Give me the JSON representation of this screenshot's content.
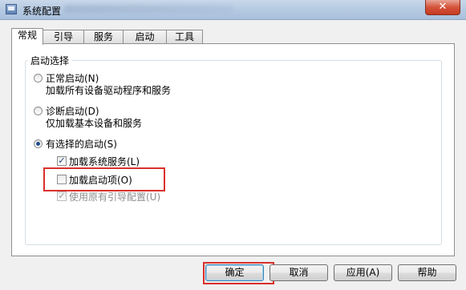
{
  "window": {
    "title": "系统配置",
    "close_glyph": "✕"
  },
  "tabs": [
    {
      "label": "常规",
      "active": true
    },
    {
      "label": "引导"
    },
    {
      "label": "服务"
    },
    {
      "label": "启动"
    },
    {
      "label": "工具"
    }
  ],
  "startup": {
    "group_label": "启动选择",
    "normal": {
      "label": "正常启动(N)",
      "desc": "加载所有设备驱动程序和服务",
      "selected": false
    },
    "diagnostic": {
      "label": "诊断启动(D)",
      "desc": "仅加载基本设备和服务",
      "selected": false
    },
    "selective": {
      "label": "有选择的启动(S)",
      "selected": true
    },
    "options": [
      {
        "label": "加载系统服务(L)",
        "checked": true,
        "enabled": true
      },
      {
        "label": "加载启动项(O)",
        "checked": false,
        "enabled": true
      },
      {
        "label": "使用原有引导配置(U)",
        "checked": true,
        "enabled": false
      }
    ]
  },
  "buttons": {
    "ok": "确定",
    "cancel": "取消",
    "apply": "应用(A)",
    "help": "帮助"
  },
  "colors": {
    "highlight": "#d9302c",
    "radio_dot": "#264f8b",
    "close": "#c63b21"
  }
}
